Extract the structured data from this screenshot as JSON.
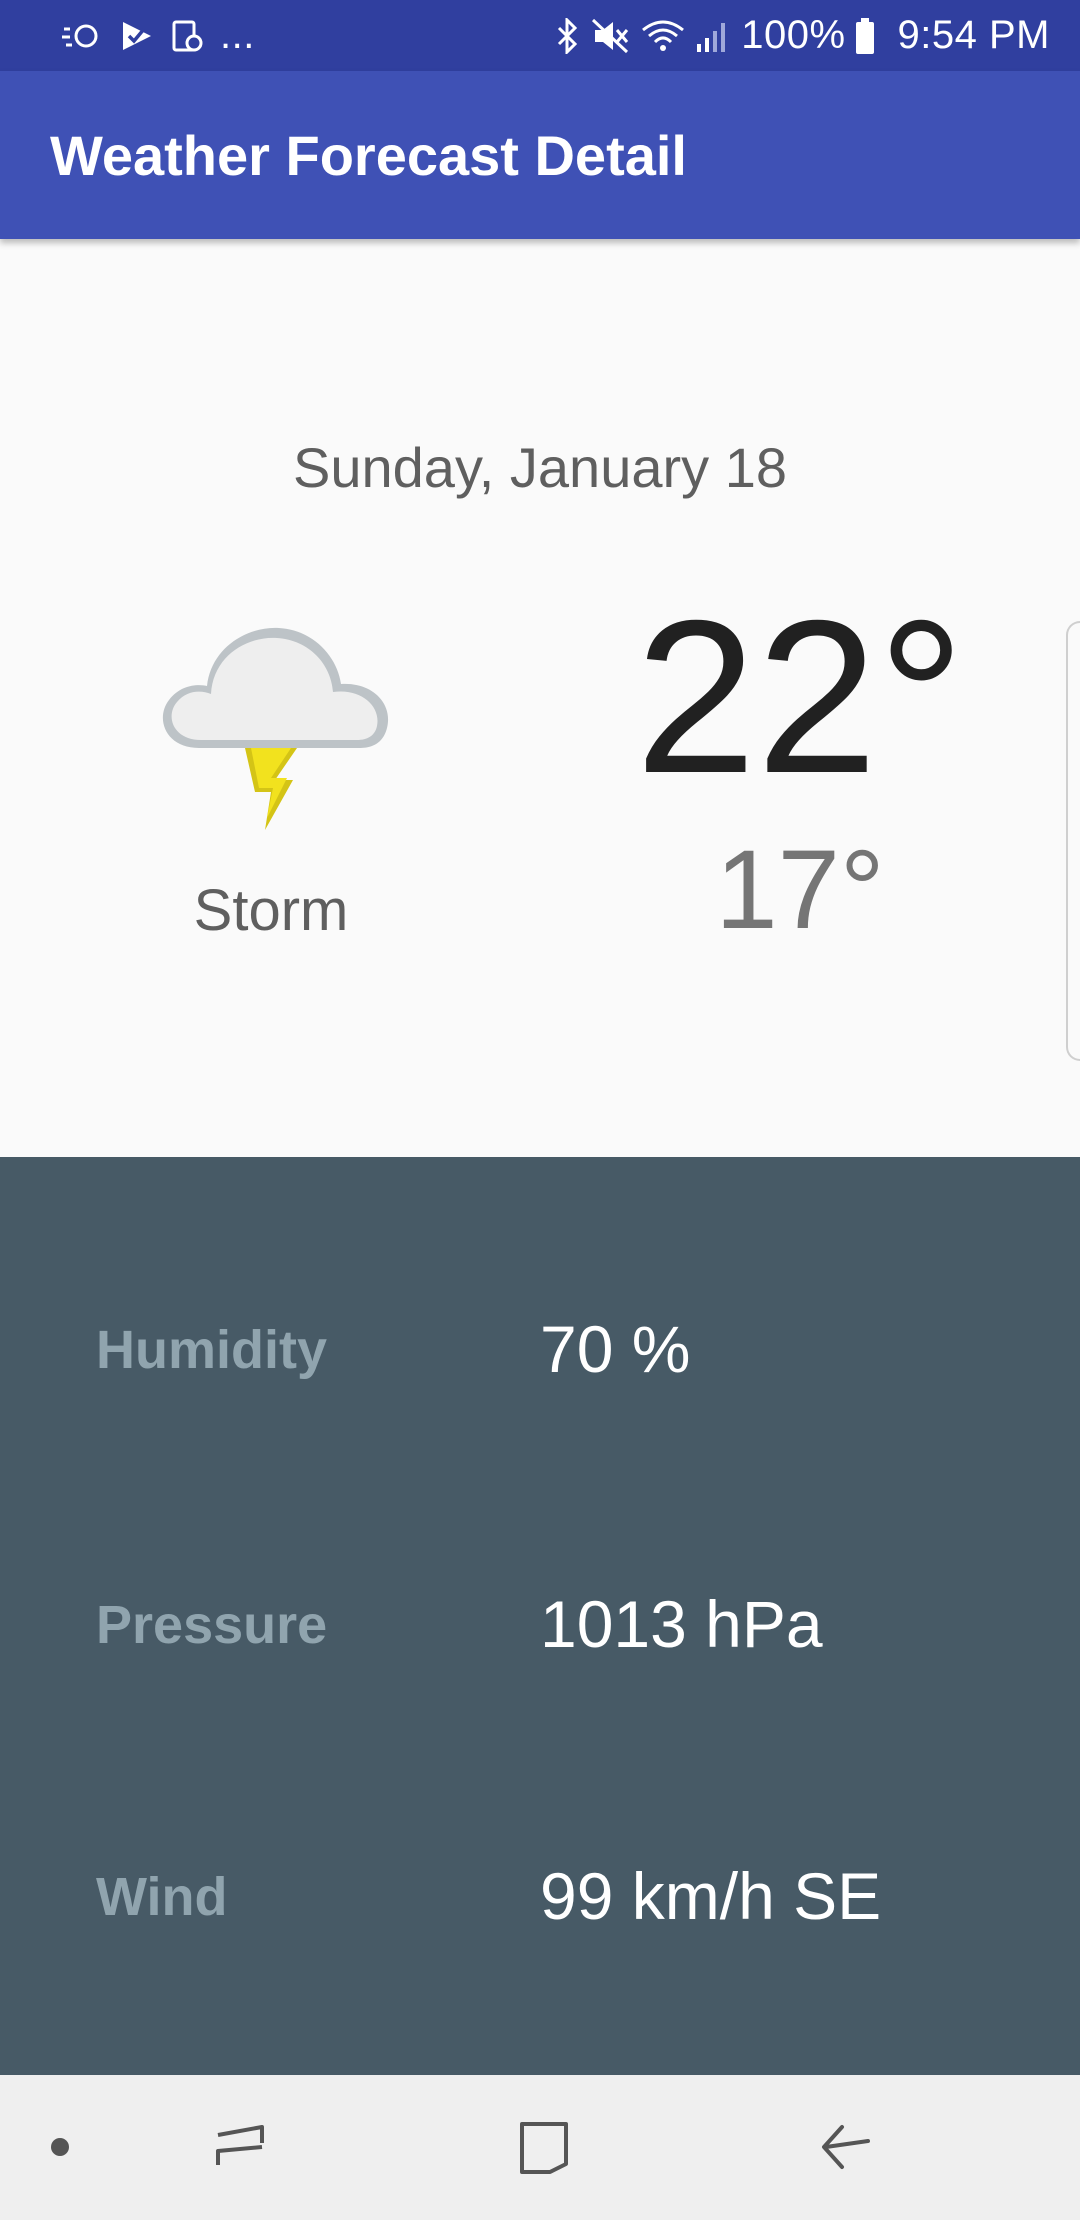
{
  "status_bar": {
    "overflow": "...",
    "battery": "100%",
    "time": "9:54 PM",
    "icons_left": [
      "assistant-icon",
      "check-icon",
      "screenshot-icon"
    ],
    "icons_right": [
      "bluetooth-icon",
      "mute-icon",
      "wifi-icon",
      "signal-icon",
      "battery-icon"
    ]
  },
  "app_bar": {
    "title": "Weather Forecast Detail",
    "color": "#3f51b5"
  },
  "forecast": {
    "date": "Sunday, January 18",
    "condition": "Storm",
    "condition_icon": "storm-icon",
    "high": "22°",
    "low": "17°"
  },
  "details": [
    {
      "label": "Humidity",
      "value": "70 %"
    },
    {
      "label": "Pressure",
      "value": "1013 hPa"
    },
    {
      "label": "Wind",
      "value": "99 km/h SE"
    }
  ],
  "nav_bar": {
    "items": [
      "dot-icon",
      "recents-icon",
      "home-icon",
      "back-icon"
    ]
  },
  "colors": {
    "status_bar": "#303f9f",
    "details_bg": "#475a66",
    "detail_label": "#90a4ae"
  }
}
